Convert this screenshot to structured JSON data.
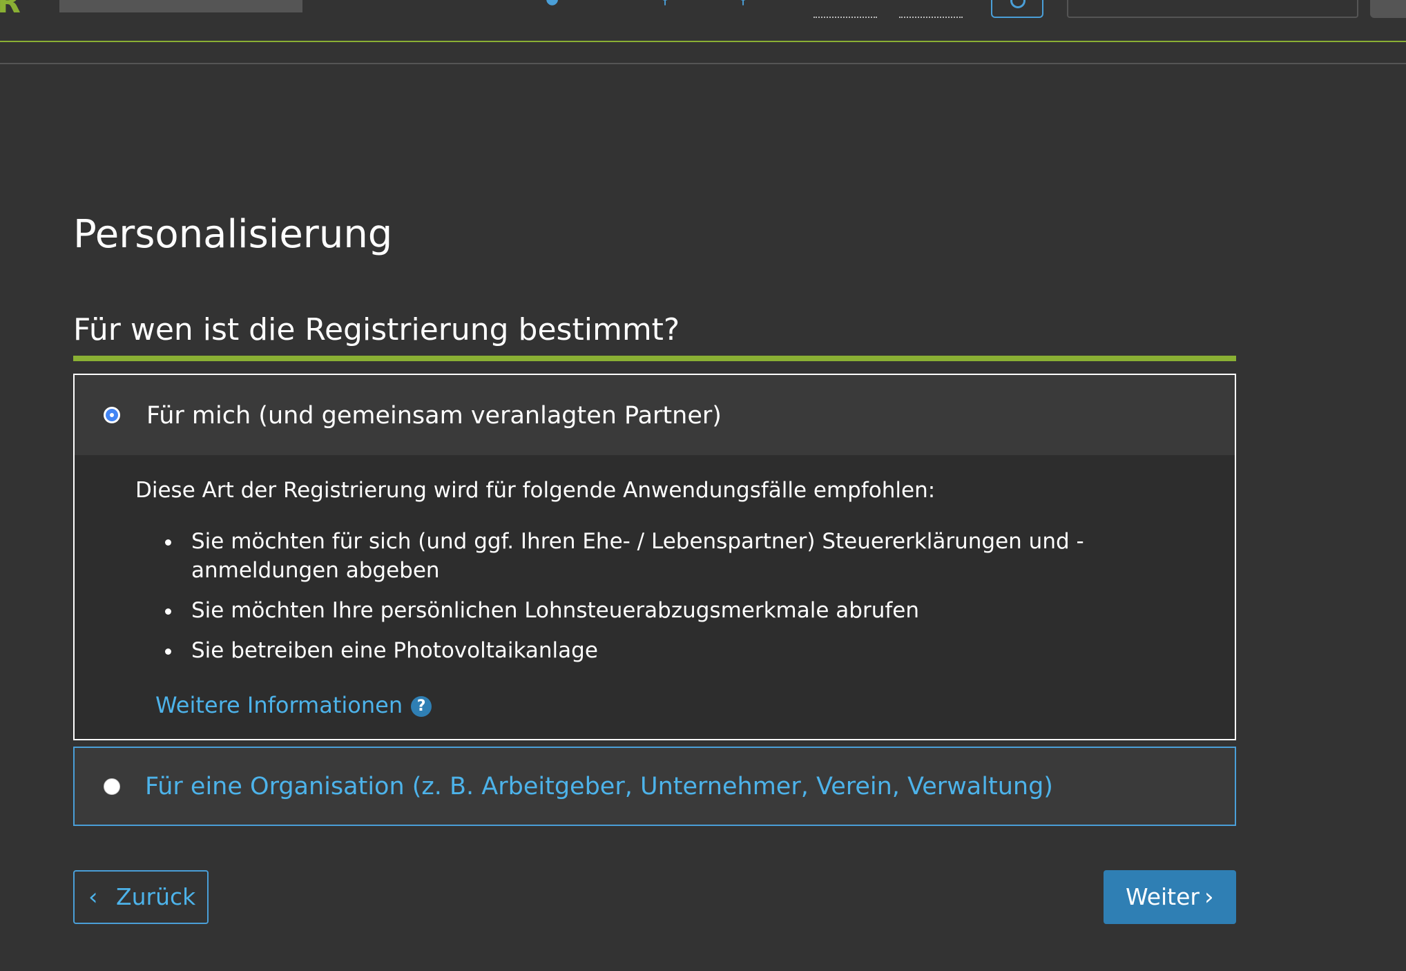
{
  "header": {
    "logo_text": "R"
  },
  "page": {
    "title": "Personalisierung",
    "question": "Für wen ist die Registrierung bestimmt?"
  },
  "options": [
    {
      "label": "Für mich (und gemeinsam veranlagten Partner)",
      "selected": true,
      "intro": "Diese Art der Registrierung wird für folgende Anwendungsfälle empfohlen:",
      "use_cases": [
        "Sie möchten für sich (und ggf. Ihren Ehe- / Lebenspartner) Steuererklärungen und -anmeldungen abgeben",
        "Sie möchten Ihre persönlichen Lohnsteuerabzugsmerkmale abrufen",
        "Sie betreiben eine Photovoltaikanlage"
      ],
      "more_info_link": "Weitere Informationen"
    },
    {
      "label": "Für eine Organisation (z. B. Arbeitgeber, Unternehmer, Verein, Verwaltung)",
      "selected": false
    }
  ],
  "buttons": {
    "back": "Zurück",
    "next": "Weiter"
  },
  "icons": {
    "help_question": "?",
    "back_chevron": "chevron-left-icon",
    "next_chevron": "chevron-right-icon"
  },
  "colors": {
    "background": "#333333",
    "accent_green": "#8ab034",
    "link_blue": "#4db3ea",
    "primary_button": "#2f7fb4"
  }
}
